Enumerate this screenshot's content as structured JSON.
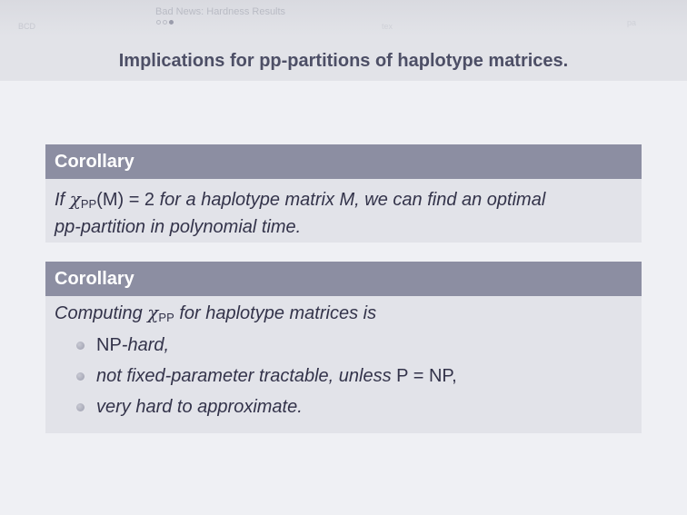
{
  "headline": {
    "left_label": "BCD",
    "section_title": "Bad News: Hardness Results",
    "subsection": "tex",
    "right_label": "pa"
  },
  "frame": {
    "title": "Implications for pp-partitions of haplotype matrices."
  },
  "corollary1": {
    "title": "Corollary",
    "line1_prefix": "If",
    "chi": "χ",
    "chi_sub": "PP",
    "paren_M": "(M) = 2",
    "line1_suffix": "for a haplotype matrix M, we can find an optimal",
    "line2": "pp-partition in polynomial time."
  },
  "corollary2": {
    "title": "Corollary",
    "intro_prefix": "Computing",
    "chi": "χ",
    "chi_sub": "PP",
    "intro_suffix": "for haplotype matrices is",
    "item1_np": "NP",
    "item1_rest": "-hard,",
    "item2_text": "not fixed-parameter tractable, unless",
    "item2_eq": "P = NP",
    "item2_end": ",",
    "item3_text": "very hard to approximate."
  }
}
